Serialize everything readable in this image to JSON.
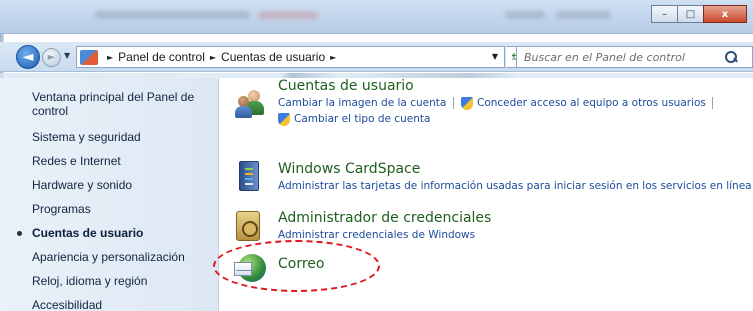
{
  "window": {
    "title": "Ajustar la configuración del equipo",
    "buttons": {
      "minimize": "–",
      "maximize": "□",
      "close": "x"
    }
  },
  "nav": {
    "back": "◄",
    "forward": "►",
    "breadcrumb": [
      "Panel de control",
      "Cuentas de usuario"
    ],
    "search_placeholder": "Buscar en el Panel de control"
  },
  "sidebar": {
    "items": [
      {
        "label": "Ventana principal del Panel de"
      },
      {
        "label": "control"
      },
      {
        "label": "Sistema y seguridad"
      },
      {
        "label": "Redes e Internet"
      },
      {
        "label": "Hardware y sonido"
      },
      {
        "label": "Programas"
      },
      {
        "label": "Cuentas de usuario",
        "active": true
      },
      {
        "label": "Apariencia y personalización"
      },
      {
        "label": "Reloj, idioma y región"
      },
      {
        "label": "Accesibilidad"
      }
    ]
  },
  "categories": [
    {
      "title": "Cuentas de usuario",
      "icon": "users-icon",
      "links": [
        "Cambiar la imagen de la cuenta",
        "Conceder acceso al equipo a otros usuarios",
        "Cambiar el tipo de cuenta"
      ]
    },
    {
      "title": "Windows CardSpace",
      "icon": "cardspace-icon",
      "links": [
        "Administrar las tarjetas de información usadas para iniciar sesión en los servicios en línea"
      ]
    },
    {
      "title": "Administrador de credenciales",
      "icon": "vault-icon",
      "links": [
        "Administrar credenciales de Windows"
      ]
    },
    {
      "title": "Correo",
      "icon": "mail-icon",
      "links": []
    }
  ],
  "annotation": {
    "color": "#e0141b",
    "style": "dashed-ellipse"
  },
  "colors": {
    "title_green": "#1e5f1e",
    "link_blue": "#1b4b9b"
  }
}
